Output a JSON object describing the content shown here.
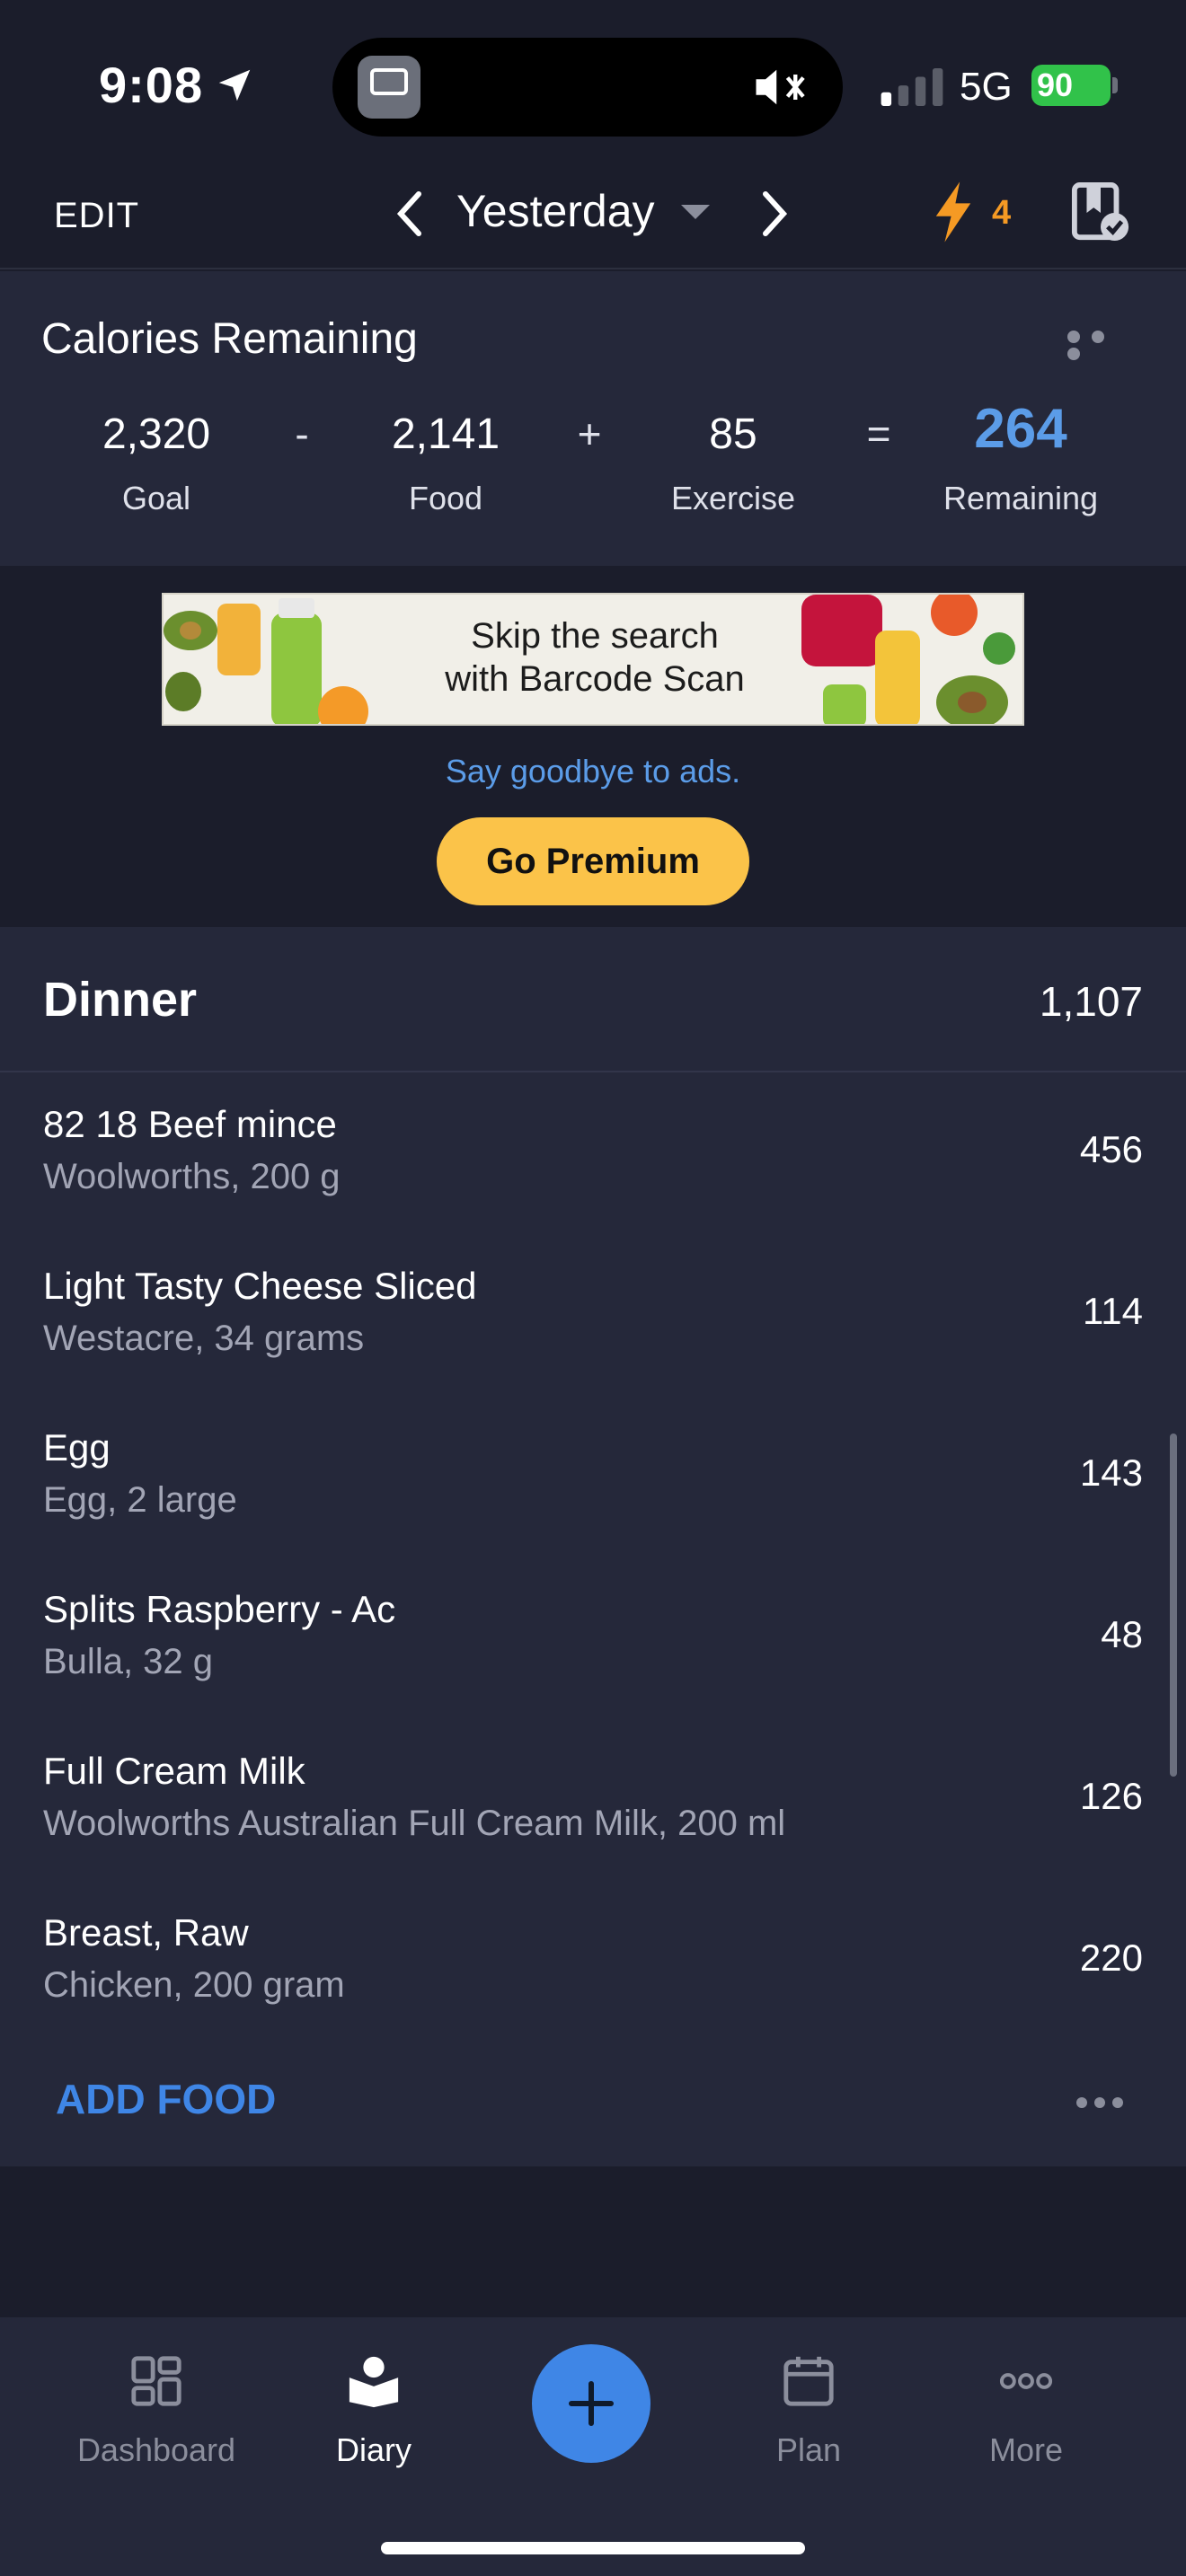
{
  "status_bar": {
    "time": "9:08",
    "network": "5G",
    "battery": "90"
  },
  "nav": {
    "edit_label": "EDIT",
    "date_label": "Yesterday",
    "streak_count": "4"
  },
  "calories": {
    "title": "Calories Remaining",
    "goal_value": "2,320",
    "goal_label": "Goal",
    "minus": "-",
    "food_value": "2,141",
    "food_label": "Food",
    "plus": "+",
    "exercise_value": "85",
    "exercise_label": "Exercise",
    "equals": "=",
    "remaining_value": "264",
    "remaining_label": "Remaining"
  },
  "ad": {
    "banner_line1": "Skip the search",
    "banner_line2": "with Barcode Scan",
    "link_text": "Say goodbye to ads.",
    "premium_label": "Go Premium"
  },
  "dinner": {
    "title": "Dinner",
    "total": "1,107",
    "items": [
      {
        "name": "82 18 Beef mince",
        "desc": "Woolworths, 200 g",
        "cal": "456"
      },
      {
        "name": "Light Tasty Cheese Sliced",
        "desc": "Westacre, 34 grams",
        "cal": "114"
      },
      {
        "name": "Egg",
        "desc": "Egg, 2 large",
        "cal": "143"
      },
      {
        "name": "Splits Raspberry - Ac",
        "desc": "Bulla, 32 g",
        "cal": "48"
      },
      {
        "name": "Full Cream Milk",
        "desc": "Woolworths Australian Full Cream Milk, 200 ml",
        "cal": "126"
      },
      {
        "name": "Breast, Raw",
        "desc": "Chicken, 200 gram",
        "cal": "220"
      }
    ],
    "add_food_label": "ADD FOOD"
  },
  "tabs": {
    "dashboard": "Dashboard",
    "diary": "Diary",
    "plan": "Plan",
    "more": "More"
  },
  "colors": {
    "accent": "#3f86e6",
    "remaining": "#5b9ce8",
    "premium": "#fbc349",
    "streak": "#f59a24"
  },
  "icons": [
    "location-arrow-icon",
    "mute-icon",
    "signal-icon",
    "battery-icon",
    "chevron-left-icon",
    "chevron-right-icon",
    "bolt-icon",
    "diary-complete-icon",
    "dashboard-icon",
    "diary-icon",
    "plus-icon",
    "plan-icon",
    "more-icon"
  ]
}
